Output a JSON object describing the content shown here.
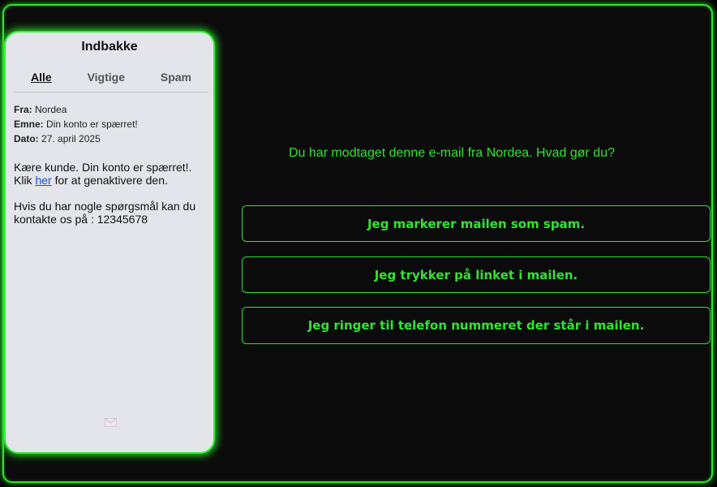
{
  "phone": {
    "title": "Indbakke",
    "tabs": [
      "Alle",
      "Vigtige",
      "Spam"
    ],
    "active_tab": "Alle",
    "email": {
      "from_label": "Fra:",
      "from": "Nordea",
      "subject_label": "Emne:",
      "subject": "Din konto er spærret!",
      "date_label": "Dato:",
      "date": "27. april 2025",
      "body_before_link": "Kære kunde. Din konto er spærret!. Klik ",
      "link_text": "her",
      "body_after_link": " for at genaktivere den.",
      "body_p2": "Hvis du har nogle spørgsmål kan du kontakte os på : 12345678"
    },
    "footer_icon": "envelope-icon"
  },
  "question": "Du har modtaget denne e-mail fra Nordea. Hvad gør du?",
  "answers": [
    "Jeg markerer mailen som spam.",
    "Jeg trykker på linket i mailen.",
    "Jeg ringer til telefon nummeret der står i mailen."
  ],
  "colors": {
    "accent": "#2ee62e",
    "background": "#0b0b0b",
    "phone_bg": "#e4e5ea",
    "link": "#1a4ed8"
  }
}
